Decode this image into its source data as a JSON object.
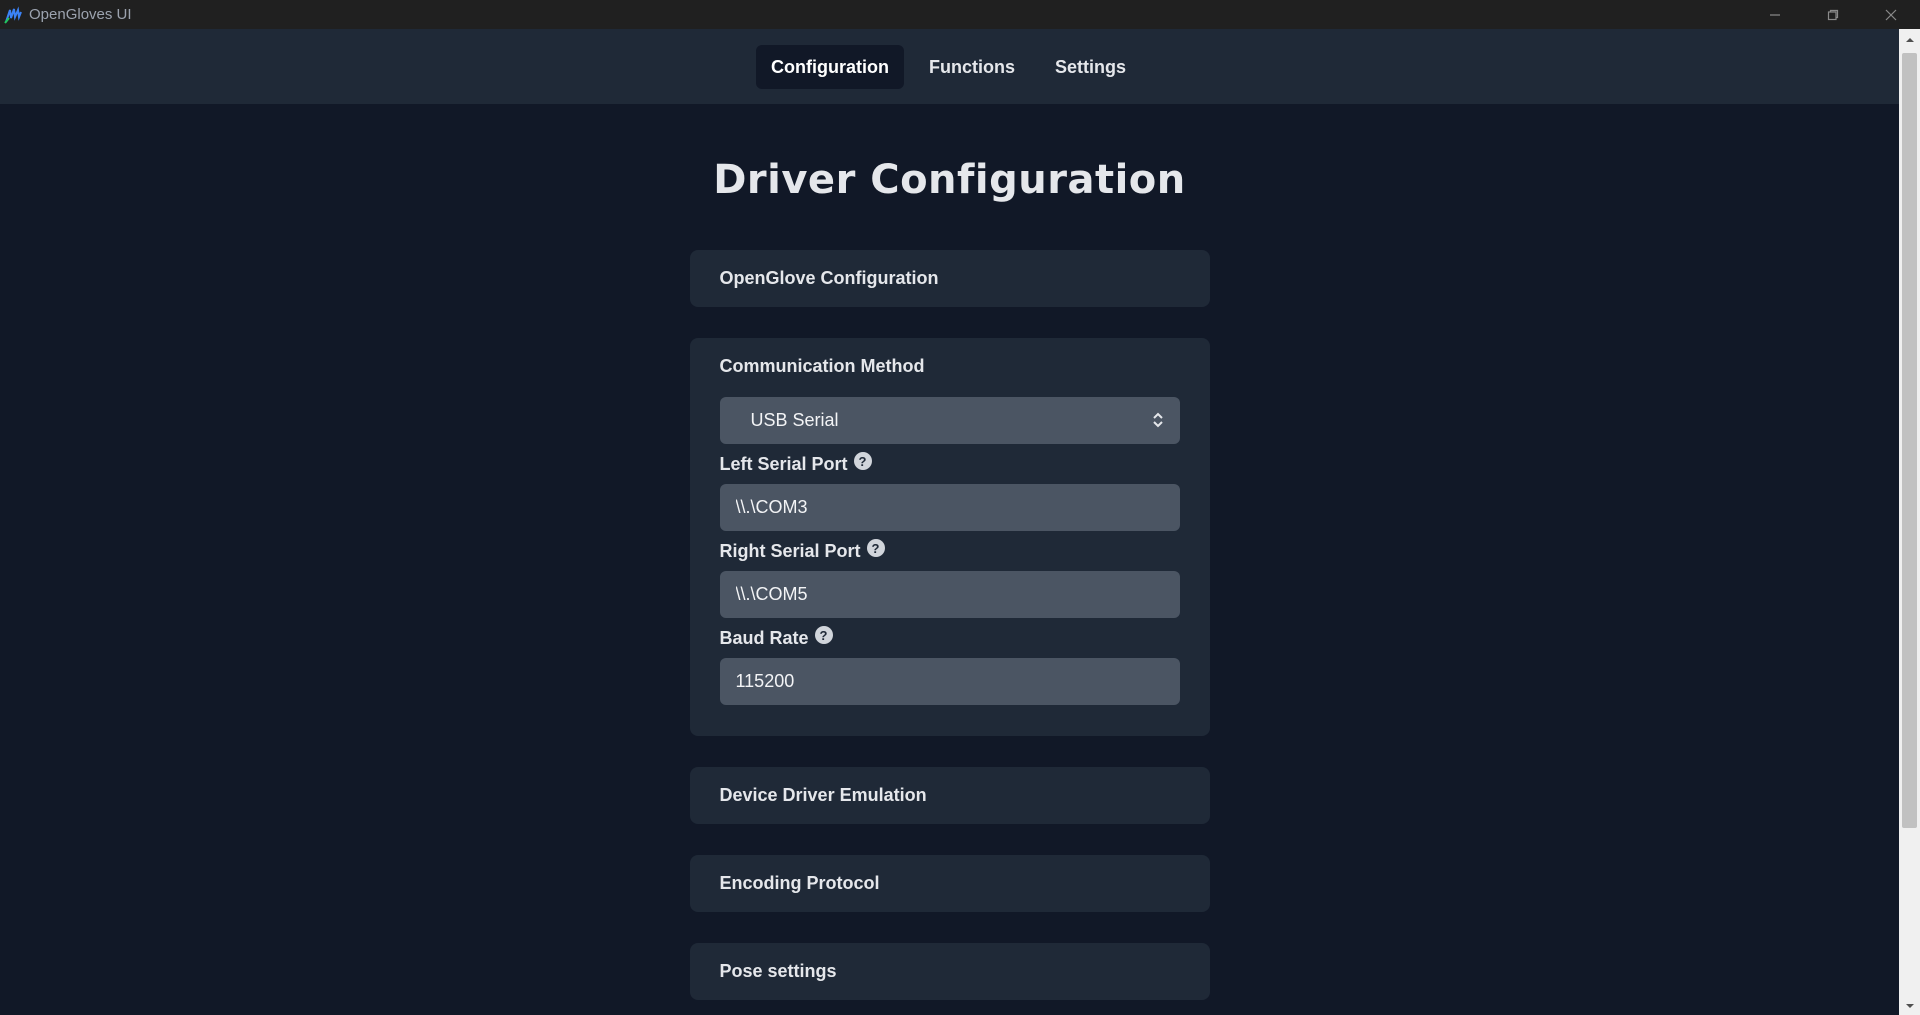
{
  "window": {
    "title": "OpenGloves UI"
  },
  "nav": {
    "tabs": [
      {
        "label": "Configuration",
        "active": true
      },
      {
        "label": "Functions",
        "active": false
      },
      {
        "label": "Settings",
        "active": false
      }
    ]
  },
  "page": {
    "title": "Driver Configuration"
  },
  "sections": {
    "openglove": {
      "title": "OpenGlove Configuration"
    },
    "communication": {
      "title": "Communication Method",
      "method_value": "USB Serial",
      "left_port_label": "Left Serial Port",
      "left_port_value": "\\\\.\\COM3",
      "right_port_label": "Right Serial Port",
      "right_port_value": "\\\\.\\COM5",
      "baud_label": "Baud Rate",
      "baud_value": "115200"
    },
    "emulation": {
      "title": "Device Driver Emulation"
    },
    "encoding": {
      "title": "Encoding Protocol"
    },
    "pose": {
      "title": "Pose settings"
    }
  },
  "colors": {
    "background": "#111827",
    "panel": "#1f2937",
    "input": "#4b5563",
    "text": "#e5e7eb"
  }
}
